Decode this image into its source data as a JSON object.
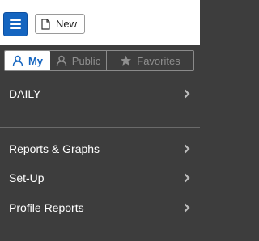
{
  "toolbar": {
    "new_label": "New"
  },
  "tabs": [
    {
      "label": "My",
      "active": true
    },
    {
      "label": "Public",
      "active": false
    },
    {
      "label": "Favorites",
      "active": false
    }
  ],
  "menu": {
    "items": [
      {
        "label": "DAILY"
      },
      {
        "label": "Reports & Graphs"
      },
      {
        "label": "Set-Up"
      },
      {
        "label": "Profile Reports"
      }
    ]
  },
  "colors": {
    "accent": "#1565c0",
    "panel_bg": "#3d3d3d",
    "muted_text": "#8f8f8f"
  },
  "icons": {
    "menu": "hamburger-menu-icon",
    "new": "document-icon",
    "my": "user-icon",
    "public": "users-icon",
    "favorites": "star-icon",
    "chevron": "chevron-right-icon"
  }
}
